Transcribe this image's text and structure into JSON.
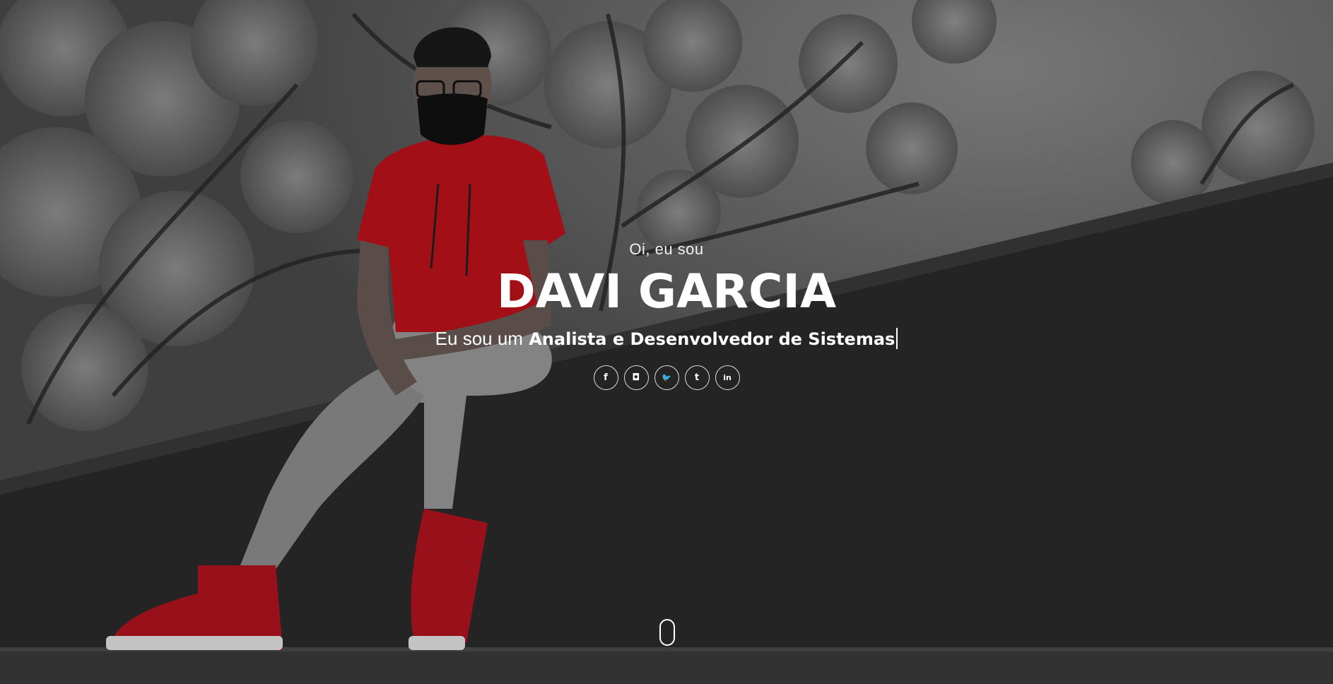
{
  "hero": {
    "greeting": "Oi, eu sou",
    "name": "DAVI GARCIA",
    "tagline_prefix": "Eu sou um",
    "tagline_role": "Analista e Desenvolvedor de Sistemas"
  },
  "socials": [
    {
      "name": "facebook",
      "glyph": "f"
    },
    {
      "name": "instagram",
      "glyph": "◘"
    },
    {
      "name": "twitter",
      "glyph": "🐦"
    },
    {
      "name": "tumblr",
      "glyph": "t"
    },
    {
      "name": "linkedin",
      "glyph": "in"
    }
  ],
  "colors": {
    "text": "#ffffff",
    "accent_red": "#c0121c"
  },
  "scroll_icon": "mouse-icon"
}
